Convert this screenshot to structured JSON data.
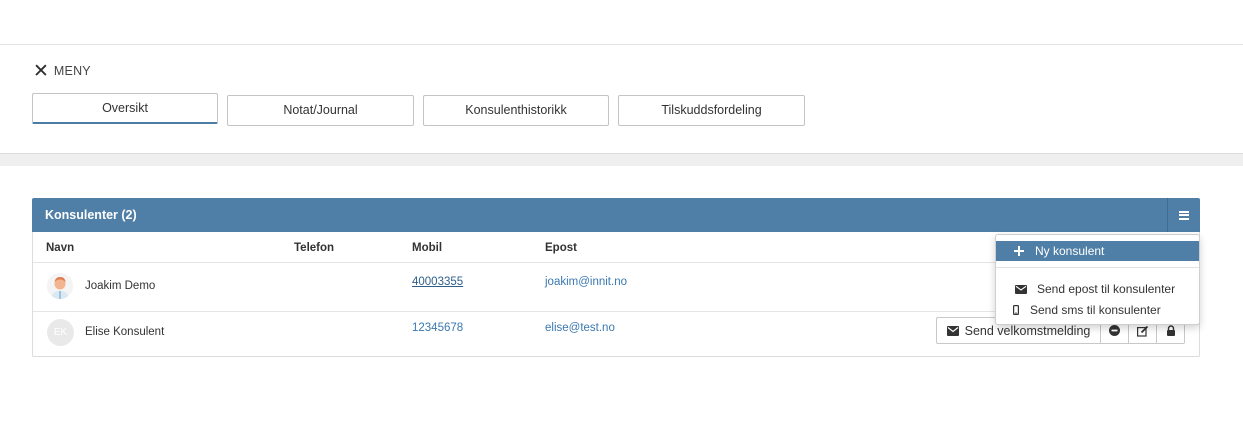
{
  "menu": {
    "icon": "close-icon",
    "label": "MENY"
  },
  "tabs": [
    {
      "label": "Oversikt",
      "active": true
    },
    {
      "label": "Notat/Journal",
      "active": false
    },
    {
      "label": "Konsulenthistorikk",
      "active": false
    },
    {
      "label": "Tilskuddsfordeling",
      "active": false
    }
  ],
  "panel": {
    "title": "Konsulenter (2)",
    "menu_icon": "hamburger-icon",
    "header_color": "#4f7fa6",
    "columns": [
      "Navn",
      "Telefon",
      "Mobil",
      "Epost"
    ],
    "rows": [
      {
        "avatar": "photo",
        "name": "Joakim Demo",
        "phone": "",
        "mobile": "40003355",
        "email": "joakim@innit.no"
      },
      {
        "avatar": "EK",
        "name": "Elise Konsulent",
        "phone": "",
        "mobile": "12345678",
        "email": "elise@test.no"
      }
    ],
    "row_actions": {
      "send_label": "Send velkomstmelding",
      "send_icon": "envelope-icon",
      "icons": [
        "minus-circle-icon",
        "edit-icon",
        "lock-icon"
      ]
    }
  },
  "dropdown": {
    "items": [
      {
        "icon": "plus-icon",
        "label": "Ny konsulent",
        "highlighted": true
      },
      {
        "icon": "envelope-icon",
        "label": "Send epost til konsulenter",
        "highlighted": false
      },
      {
        "icon": "mobile-icon",
        "label": "Send sms til konsulenter",
        "highlighted": false
      }
    ]
  }
}
